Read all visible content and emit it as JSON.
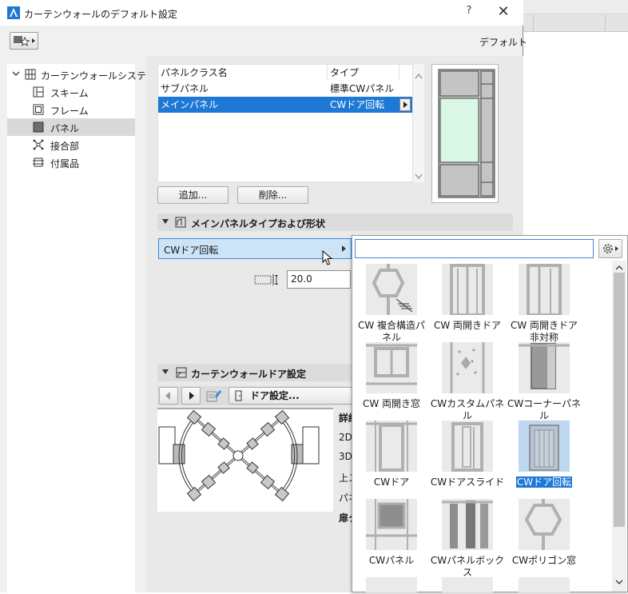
{
  "window": {
    "title": "カーテンウォールのデフォルト設定",
    "help": "?",
    "close": "✕"
  },
  "header": {
    "default_label": "デフォルト"
  },
  "tree": {
    "root": "カーテンウォールシステム",
    "items": [
      {
        "label": "スキーム"
      },
      {
        "label": "フレーム"
      },
      {
        "label": "パネル"
      },
      {
        "label": "接合部"
      },
      {
        "label": "付属品"
      }
    ]
  },
  "panel_table": {
    "headers": [
      "パネルクラス名",
      "タイプ"
    ],
    "rows": [
      {
        "name": "サブパネル",
        "type": "標準CWパネル"
      },
      {
        "name": "メインパネル",
        "type": "CWドア回転"
      }
    ],
    "add_button": "追加...",
    "delete_button": "削除..."
  },
  "main_panel_section": {
    "title": "メインパネルタイプおよび形状",
    "type_value": "CWドア回転",
    "dim_value": "20.0"
  },
  "door_section": {
    "title": "カーテンウォールドア設定",
    "door_settings_button": "ドア設定...",
    "side_labels": [
      "詳細",
      "2D",
      "3D",
      "上ス",
      "パネ",
      "扉ク"
    ]
  },
  "popup": {
    "search_placeholder": "",
    "items": [
      {
        "label": "CW 複合構造パネル"
      },
      {
        "label": "CW 両開きドア"
      },
      {
        "label": "CW 両開きドア非対称"
      },
      {
        "label": "CW 両開き窓"
      },
      {
        "label": "CWカスタムパネル"
      },
      {
        "label": "CWコーナーパネル"
      },
      {
        "label": "CWドア"
      },
      {
        "label": "CWドアスライド"
      },
      {
        "label": "CWドア回転"
      },
      {
        "label": "CWパネル"
      },
      {
        "label": "CWパネルボックス"
      },
      {
        "label": "CWポリゴン窓"
      }
    ]
  },
  "colors": {
    "accent": "#1e78d6",
    "selection_light": "#cce4f7",
    "glass": "#d9f7e4"
  }
}
